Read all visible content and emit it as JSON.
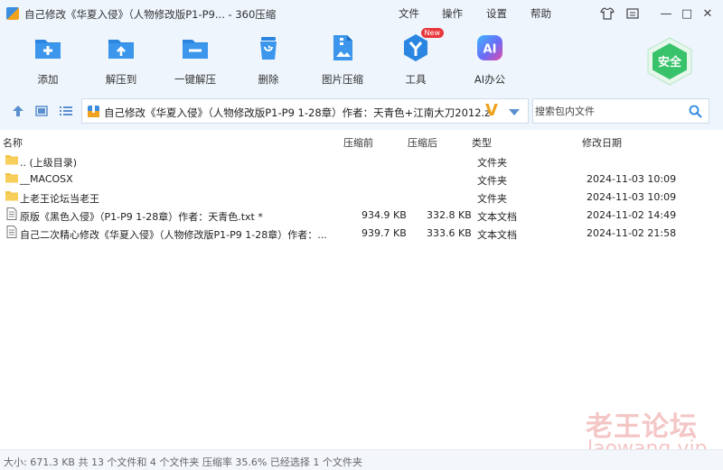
{
  "window": {
    "title": "自己修改《华夏入侵》（人物修改版P1-P9... - 360压缩",
    "menu": [
      "文件",
      "操作",
      "设置",
      "帮助"
    ],
    "controls": {
      "skin": "skin-icon",
      "menu": "menu-icon",
      "minimize": "—",
      "maximize": "□",
      "close": "✕"
    }
  },
  "toolbar": {
    "tools": [
      {
        "label": "添加",
        "icon": "add-icon"
      },
      {
        "label": "解压到",
        "icon": "extract-to-icon"
      },
      {
        "label": "一键解压",
        "icon": "one-click-extract-icon"
      },
      {
        "label": "删除",
        "icon": "delete-icon"
      },
      {
        "label": "图片压缩",
        "icon": "image-compress-icon"
      },
      {
        "label": "工具",
        "icon": "tools-icon",
        "badge": "New"
      },
      {
        "label": "AI办公",
        "icon": "ai-office-icon",
        "icon_text": "AI"
      }
    ],
    "safe_label": "安全"
  },
  "address": {
    "path": "自己修改《华夏入侵》（人物修改版P1-P9 1-28章）作者：天青色+江南大刀2012.z",
    "search_placeholder": "搜索包内文件"
  },
  "columns": {
    "name": "名称",
    "packed": "压缩前",
    "compressed": "压缩后",
    "type": "类型",
    "modified": "修改日期"
  },
  "files": [
    {
      "name": ".. (上级目录)",
      "packed": "",
      "compressed": "",
      "type": "文件夹",
      "modified": "",
      "kind": "folder"
    },
    {
      "name": "__MACOSX",
      "packed": "",
      "compressed": "",
      "type": "文件夹",
      "modified": "2024-11-03 10:09",
      "kind": "folder"
    },
    {
      "name": "上老王论坛当老王",
      "packed": "",
      "compressed": "",
      "type": "文件夹",
      "modified": "2024-11-03 10:09",
      "kind": "folder"
    },
    {
      "name": "原版《黑色入侵》（P1-P9 1-28章）作者：天青色.txt *",
      "packed": "934.9 KB",
      "compressed": "332.8 KB",
      "type": "文本文档",
      "modified": "2024-11-02 14:49",
      "kind": "text"
    },
    {
      "name": "自己二次精心修改《华夏入侵》（人物修改版P1-P9  1-28章）作者：...",
      "packed": "939.7 KB",
      "compressed": "333.6 KB",
      "type": "文本文档",
      "modified": "2024-11-02 21:58",
      "kind": "text"
    }
  ],
  "watermark": {
    "line1": "老王论坛",
    "line2": "laowang.vip"
  },
  "status": "大小: 671.3 KB 共 13 个文件和 4 个文件夹 压缩率 35.6% 已经选择 1 个文件夹",
  "colors": {
    "accent": "#2a86e0",
    "toolbar_bg": "#eef5fd",
    "folder": "#f5c242",
    "safe_green": "#38c36b",
    "badge_red": "#e8383d"
  }
}
